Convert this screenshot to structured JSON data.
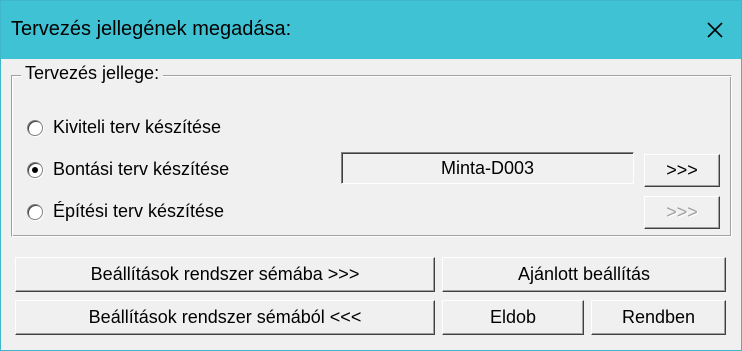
{
  "window": {
    "title": "Tervezés jellegének megadása:",
    "close_icon": "close-icon",
    "colors": {
      "titlebar": "#3fc3d4",
      "border": "#3fb6c9",
      "face": "#f0f0f0"
    }
  },
  "group": {
    "legend": "Tervezés jellege:",
    "options": [
      {
        "label": "Kiviteli terv készítése",
        "checked": false
      },
      {
        "label": "Bontási terv készítése",
        "checked": true
      },
      {
        "label": "Építési terv készítése",
        "checked": false
      }
    ],
    "plan_name_value": "Minta-D003",
    "browse_button_label": ">>>",
    "browse_button_disabled_label": ">>>"
  },
  "buttons": {
    "save_to_schema": "Beállítások rendszer sémába >>>",
    "recommended": "Ajánlott beállítás",
    "load_from_schema": "Beállítások rendszer sémából <<<",
    "discard": "Eldob",
    "ok": "Rendben"
  }
}
